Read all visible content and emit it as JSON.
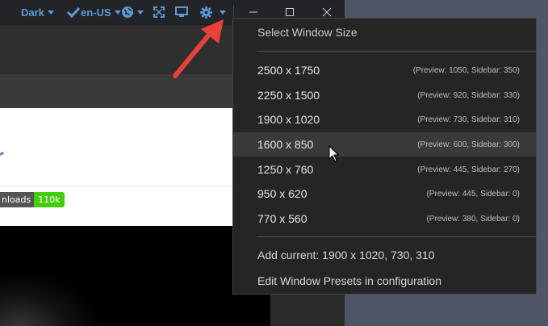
{
  "titlebar": {
    "theme_label": "Dark",
    "lang_label": "en-US"
  },
  "content": {
    "heading": "r",
    "badge_left": "nloads",
    "badge_right": "110k"
  },
  "menu": {
    "title": "Select Window Size",
    "presets": [
      {
        "size": "2500 x 1750",
        "meta": "(Preview: 1050,  Sidebar: 350)"
      },
      {
        "size": "2250 x 1500",
        "meta": "(Preview: 920,  Sidebar: 330)"
      },
      {
        "size": "1900 x 1020",
        "meta": "(Preview: 730,  Sidebar: 310)"
      },
      {
        "size": "1600 x 850",
        "meta": "(Preview: 600,  Sidebar: 300)"
      },
      {
        "size": "1250 x 760",
        "meta": "(Preview: 445,  Sidebar: 270)"
      },
      {
        "size": "950 x 620",
        "meta": "(Preview: 445,  Sidebar: 0)"
      },
      {
        "size": "770 x 560",
        "meta": "(Preview: 380,  Sidebar: 0)"
      }
    ],
    "add_current": "Add current: 1900 x 1020, 730, 310",
    "edit_presets": "Edit Window Presets in configuration"
  },
  "colors": {
    "accent": "#5b9bd5",
    "annotation_arrow": "#e8413b",
    "badge_green": "#44cc11"
  },
  "icons": [
    "checkmark-icon",
    "globe-icon",
    "fullscreen-icon",
    "monitor-icon",
    "gear-icon",
    "chevron-down-icon",
    "minimize-icon",
    "maximize-icon",
    "close-icon",
    "annotation-arrow-icon",
    "mouse-cursor-icon"
  ]
}
